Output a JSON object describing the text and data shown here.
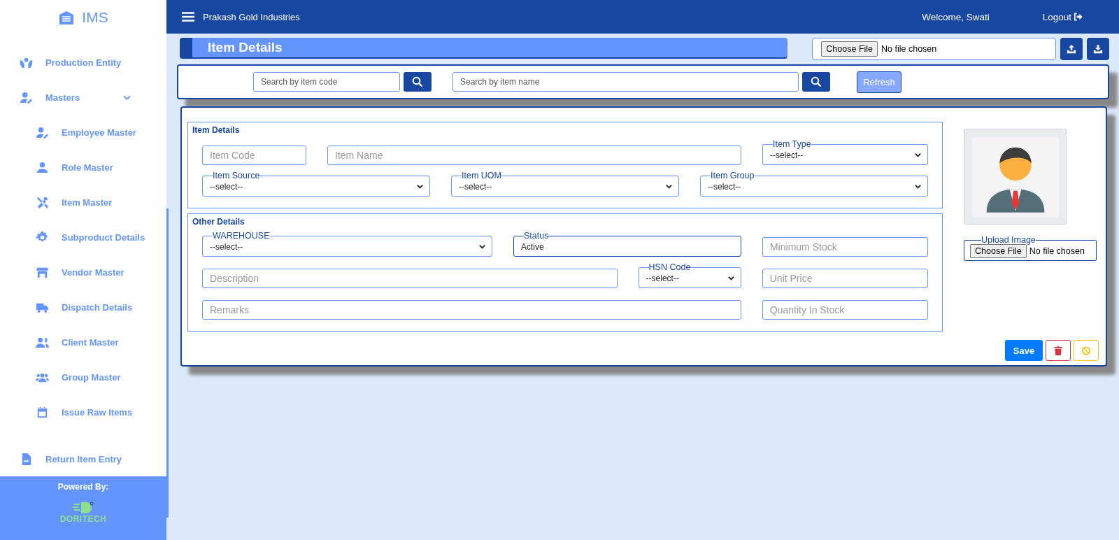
{
  "sidebar": {
    "logo": "IMS",
    "items": [
      {
        "label": "Production Entity"
      },
      {
        "label": "Masters",
        "expanded": true,
        "children": [
          {
            "label": "Employee Master"
          },
          {
            "label": "Role Master"
          },
          {
            "label": "Item Master"
          },
          {
            "label": "Subproduct Details"
          },
          {
            "label": "Vendor Master"
          },
          {
            "label": "Dispatch Details"
          },
          {
            "label": "Client Master"
          },
          {
            "label": "Group Master"
          },
          {
            "label": "Issue Raw Items"
          }
        ]
      },
      {
        "label": "Return Item Entry"
      }
    ],
    "footer": {
      "caption": "Powered By:",
      "logo": "DORITECH"
    }
  },
  "header": {
    "company": "Prakash Gold Industries",
    "welcome": "Welcome, Swati",
    "logout": "Logout"
  },
  "page_title": "Item Details",
  "import_file": {
    "button": "Choose File",
    "status": "No file chosen"
  },
  "search": {
    "code_placeholder": "Search by item code",
    "name_placeholder": "Search by item name",
    "refresh": "Refresh"
  },
  "sections": [
    {
      "title": "Item Details",
      "rows": [
        [
          {
            "kind": "text",
            "placeholder": "Item Code"
          },
          {
            "kind": "text",
            "placeholder": "Item Name"
          },
          {
            "kind": "select",
            "label": "Item Type",
            "value": "--select--"
          }
        ],
        [
          {
            "kind": "select",
            "label": "Item Source",
            "value": "--select--"
          },
          {
            "kind": "select",
            "label": "Item UOM",
            "value": "--select--"
          },
          {
            "kind": "select",
            "label": "Item Group",
            "value": "--select--"
          }
        ]
      ]
    },
    {
      "title": "Other Details",
      "rows": [
        [
          {
            "kind": "select",
            "label": "WAREHOUSE",
            "value": "--select--"
          },
          {
            "kind": "input",
            "label": "Status",
            "value": "Active"
          },
          {
            "kind": "text",
            "placeholder": "Minimum Stock"
          }
        ],
        [
          {
            "kind": "text",
            "placeholder": "Description"
          },
          {
            "kind": "select",
            "label": "HSN Code",
            "value": "--select--"
          },
          {
            "kind": "text",
            "placeholder": "Unit Price"
          }
        ],
        [
          {
            "kind": "text",
            "placeholder": "Remarks"
          },
          "",
          {
            "kind": "text",
            "placeholder": "Quantity In Stock"
          }
        ]
      ]
    }
  ],
  "upload": {
    "label": "Upload Image",
    "button": "Choose File",
    "status": "No file chosen"
  },
  "actions": {
    "save": "Save"
  }
}
